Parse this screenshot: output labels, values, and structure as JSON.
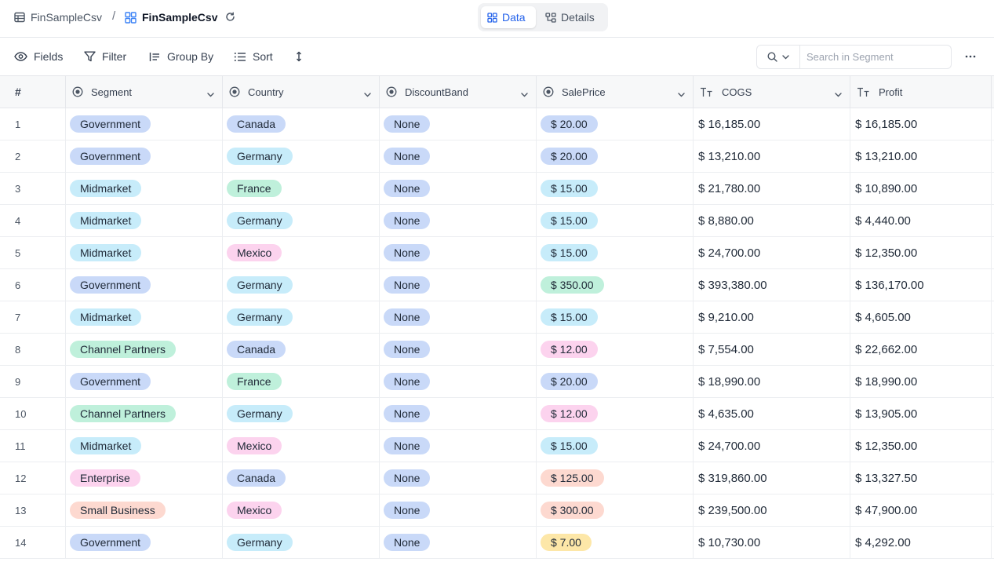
{
  "breadcrumb": {
    "base": "FinSampleCsv",
    "separator": "/",
    "table": "FinSampleCsv"
  },
  "views": {
    "data": "Data",
    "details": "Details"
  },
  "toolbar": {
    "fields": "Fields",
    "filter": "Filter",
    "group_by": "Group By",
    "sort": "Sort"
  },
  "search": {
    "placeholder": "Search in Segment"
  },
  "colors": {
    "accent": "#2563eb",
    "blue": "#c9d9f8",
    "cyan": "#c7ecfa",
    "green": "#bff0db",
    "pink": "#fcd3ee",
    "salmon": "#fdd9d0",
    "yellow": "#fde7a8"
  },
  "columns": [
    {
      "label": "#"
    },
    {
      "label": "Segment",
      "icon": "single-select-icon"
    },
    {
      "label": "Country",
      "icon": "single-select-icon"
    },
    {
      "label": "DiscountBand",
      "icon": "single-select-icon"
    },
    {
      "label": "SalePrice",
      "icon": "single-select-icon"
    },
    {
      "label": "COGS",
      "icon": "text-icon"
    },
    {
      "label": "Profit",
      "icon": "text-icon"
    }
  ],
  "rows": [
    {
      "num": "1",
      "segment": {
        "text": "Government",
        "color": "blue"
      },
      "country": {
        "text": "Canada",
        "color": "blue"
      },
      "discount": "None",
      "price": {
        "text": "$ 20.00",
        "color": "blue"
      },
      "cogs": "$ 16,185.00",
      "profit": "$ 16,185.00"
    },
    {
      "num": "2",
      "segment": {
        "text": "Government",
        "color": "blue"
      },
      "country": {
        "text": "Germany",
        "color": "cyan"
      },
      "discount": "None",
      "price": {
        "text": "$ 20.00",
        "color": "blue"
      },
      "cogs": "$ 13,210.00",
      "profit": "$ 13,210.00"
    },
    {
      "num": "3",
      "segment": {
        "text": "Midmarket",
        "color": "cyan"
      },
      "country": {
        "text": "France",
        "color": "green"
      },
      "discount": "None",
      "price": {
        "text": "$ 15.00",
        "color": "cyan"
      },
      "cogs": "$ 21,780.00",
      "profit": "$ 10,890.00"
    },
    {
      "num": "4",
      "segment": {
        "text": "Midmarket",
        "color": "cyan"
      },
      "country": {
        "text": "Germany",
        "color": "cyan"
      },
      "discount": "None",
      "price": {
        "text": "$ 15.00",
        "color": "cyan"
      },
      "cogs": "$ 8,880.00",
      "profit": "$ 4,440.00"
    },
    {
      "num": "5",
      "segment": {
        "text": "Midmarket",
        "color": "cyan"
      },
      "country": {
        "text": "Mexico",
        "color": "pink"
      },
      "discount": "None",
      "price": {
        "text": "$ 15.00",
        "color": "cyan"
      },
      "cogs": "$ 24,700.00",
      "profit": "$ 12,350.00"
    },
    {
      "num": "6",
      "segment": {
        "text": "Government",
        "color": "blue"
      },
      "country": {
        "text": "Germany",
        "color": "cyan"
      },
      "discount": "None",
      "price": {
        "text": "$ 350.00",
        "color": "green"
      },
      "cogs": "$ 393,380.00",
      "profit": "$ 136,170.00"
    },
    {
      "num": "7",
      "segment": {
        "text": "Midmarket",
        "color": "cyan"
      },
      "country": {
        "text": "Germany",
        "color": "cyan"
      },
      "discount": "None",
      "price": {
        "text": "$ 15.00",
        "color": "cyan"
      },
      "cogs": "$ 9,210.00",
      "profit": "$ 4,605.00"
    },
    {
      "num": "8",
      "segment": {
        "text": "Channel Partners",
        "color": "green"
      },
      "country": {
        "text": "Canada",
        "color": "blue"
      },
      "discount": "None",
      "price": {
        "text": "$ 12.00",
        "color": "pink"
      },
      "cogs": "$ 7,554.00",
      "profit": "$ 22,662.00"
    },
    {
      "num": "9",
      "segment": {
        "text": "Government",
        "color": "blue"
      },
      "country": {
        "text": "France",
        "color": "green"
      },
      "discount": "None",
      "price": {
        "text": "$ 20.00",
        "color": "blue"
      },
      "cogs": "$ 18,990.00",
      "profit": "$ 18,990.00"
    },
    {
      "num": "10",
      "segment": {
        "text": "Channel Partners",
        "color": "green"
      },
      "country": {
        "text": "Germany",
        "color": "cyan"
      },
      "discount": "None",
      "price": {
        "text": "$ 12.00",
        "color": "pink"
      },
      "cogs": "$ 4,635.00",
      "profit": "$ 13,905.00"
    },
    {
      "num": "11",
      "segment": {
        "text": "Midmarket",
        "color": "cyan"
      },
      "country": {
        "text": "Mexico",
        "color": "pink"
      },
      "discount": "None",
      "price": {
        "text": "$ 15.00",
        "color": "cyan"
      },
      "cogs": "$ 24,700.00",
      "profit": "$ 12,350.00"
    },
    {
      "num": "12",
      "segment": {
        "text": "Enterprise",
        "color": "pink"
      },
      "country": {
        "text": "Canada",
        "color": "blue"
      },
      "discount": "None",
      "price": {
        "text": "$ 125.00",
        "color": "salmon"
      },
      "cogs": "$ 319,860.00",
      "profit": "$ 13,327.50"
    },
    {
      "num": "13",
      "segment": {
        "text": "Small Business",
        "color": "salmon"
      },
      "country": {
        "text": "Mexico",
        "color": "pink"
      },
      "discount": "None",
      "price": {
        "text": "$ 300.00",
        "color": "salmon"
      },
      "cogs": "$ 239,500.00",
      "profit": "$ 47,900.00"
    },
    {
      "num": "14",
      "segment": {
        "text": "Government",
        "color": "blue"
      },
      "country": {
        "text": "Germany",
        "color": "cyan"
      },
      "discount": "None",
      "price": {
        "text": "$ 7.00",
        "color": "yellow"
      },
      "cogs": "$ 10,730.00",
      "profit": "$ 4,292.00"
    }
  ]
}
